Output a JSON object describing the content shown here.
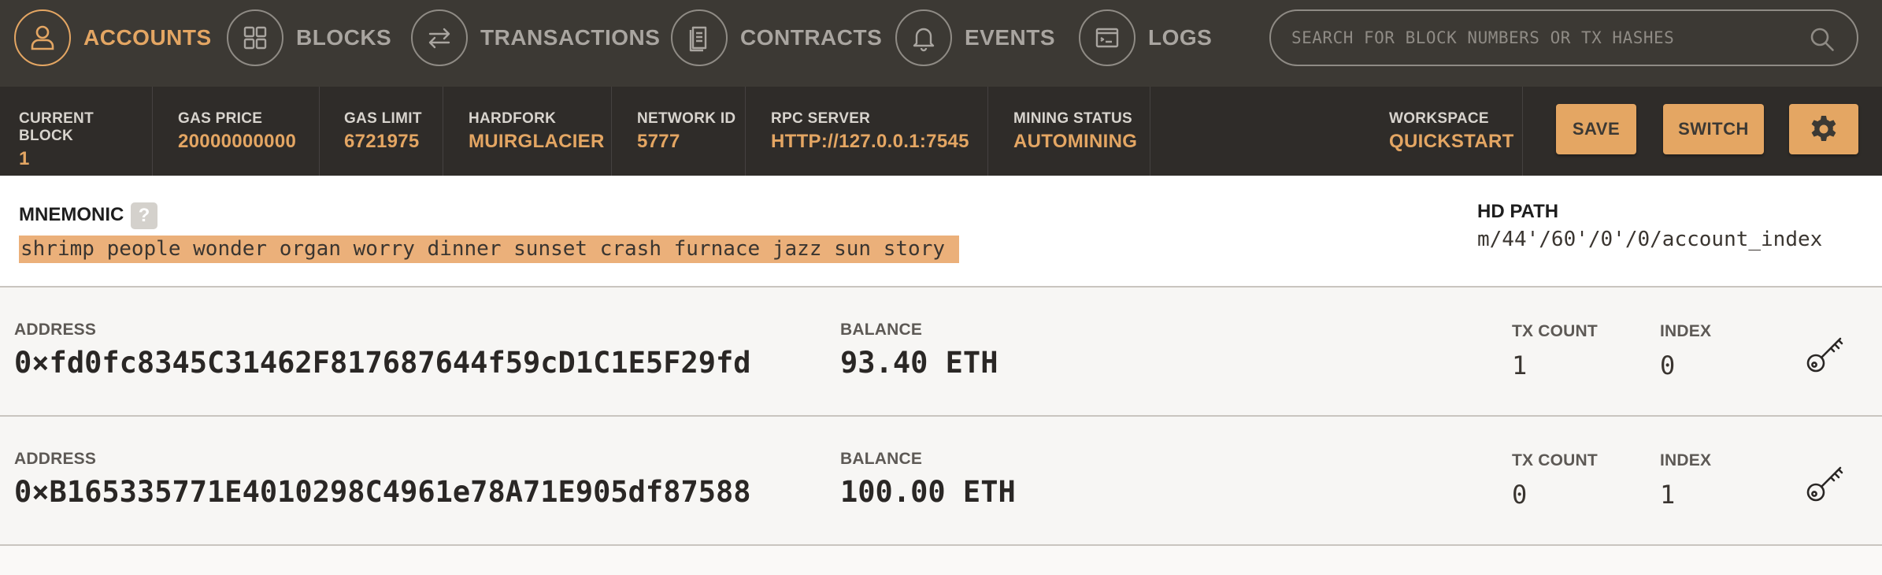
{
  "nav": {
    "items": [
      {
        "label": "ACCOUNTS",
        "icon": "person-icon",
        "active": true
      },
      {
        "label": "BLOCKS",
        "icon": "grid-icon",
        "active": false
      },
      {
        "label": "TRANSACTIONS",
        "icon": "swap-arrows-icon",
        "active": false
      },
      {
        "label": "CONTRACTS",
        "icon": "document-icon",
        "active": false
      },
      {
        "label": "EVENTS",
        "icon": "bell-icon",
        "active": false
      },
      {
        "label": "LOGS",
        "icon": "terminal-window-icon",
        "active": false
      }
    ],
    "search": {
      "placeholder": "SEARCH FOR BLOCK NUMBERS OR TX HASHES",
      "icon": "search-icon"
    }
  },
  "status": {
    "current_block": {
      "label": "CURRENT BLOCK",
      "value": "1"
    },
    "gas_price": {
      "label": "GAS PRICE",
      "value": "20000000000"
    },
    "gas_limit": {
      "label": "GAS LIMIT",
      "value": "6721975"
    },
    "hardfork": {
      "label": "HARDFORK",
      "value": "MUIRGLACIER"
    },
    "network_id": {
      "label": "NETWORK ID",
      "value": "5777"
    },
    "rpc_server": {
      "label": "RPC SERVER",
      "value": "HTTP://127.0.0.1:7545"
    },
    "mining_status": {
      "label": "MINING STATUS",
      "value": "AUTOMINING"
    },
    "workspace": {
      "label": "WORKSPACE",
      "value": "QUICKSTART"
    },
    "save_label": "SAVE",
    "switch_label": "SWITCH",
    "settings_icon": "gear-icon"
  },
  "mnemonic": {
    "label": "MNEMONIC",
    "help": "?",
    "phrase": "shrimp people wonder organ worry dinner sunset crash furnace jazz sun story",
    "hd_path_label": "HD PATH",
    "hd_path": "m/44'/60'/0'/0/account_index"
  },
  "accounts": [
    {
      "address_label": "ADDRESS",
      "address": "0×fd0fc8345C31462F817687644f59cD1C1E5F29fd",
      "balance_label": "BALANCE",
      "balance": "93.40 ETH",
      "tx_count_label": "TX COUNT",
      "tx_count": "1",
      "index_label": "INDEX",
      "index": "0",
      "key_icon": "key-icon"
    },
    {
      "address_label": "ADDRESS",
      "address": "0×B165335771E4010298C4961e78A71E905df87588",
      "balance_label": "BALANCE",
      "balance": "100.00 ETH",
      "tx_count_label": "TX COUNT",
      "tx_count": "0",
      "index_label": "INDEX",
      "index": "1",
      "key_icon": "key-icon"
    }
  ],
  "colors": {
    "nav_bg": "#3c3934",
    "status_bg": "#2f2c29",
    "accent": "#e4a663",
    "mnemonic_highlight": "#ebb07a",
    "page_bg": "#faf9f7"
  }
}
